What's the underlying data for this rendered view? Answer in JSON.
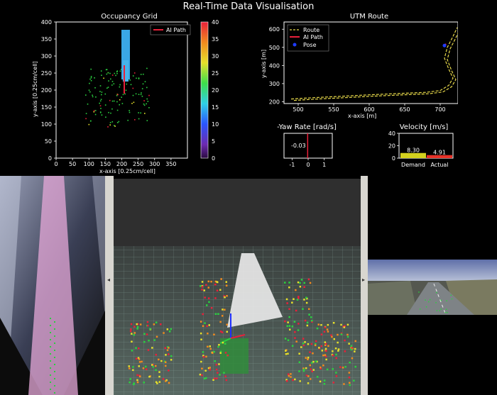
{
  "window_title": "Real-Time Data Visualisation",
  "occupancy": {
    "title": "Occupancy Grid",
    "xlabel": "x-axis [0.25cm/cell]",
    "ylabel": "y-axis [0.25cm/cell]",
    "xticks": [
      "0",
      "50",
      "100",
      "150",
      "200",
      "250",
      "300",
      "350"
    ],
    "yticks": [
      "0",
      "50",
      "100",
      "150",
      "200",
      "250",
      "300",
      "350",
      "400"
    ],
    "legend": "AI Path",
    "colorbar_ticks": [
      "0",
      "5",
      "10",
      "15",
      "20",
      "25",
      "30",
      "35",
      "40"
    ]
  },
  "utm": {
    "title": "UTM Route",
    "xlabel": "x-axis [m]",
    "ylabel": "y-axis [m]",
    "xticks": [
      "500",
      "550",
      "600",
      "650",
      "700"
    ],
    "yticks": [
      "200",
      "300",
      "400",
      "500",
      "600"
    ],
    "legend": [
      "Route",
      "AI Path",
      "Pose"
    ]
  },
  "yaw": {
    "title": "-Yaw Rate [rad/s]",
    "value": "-0.03",
    "xticks": [
      "-1",
      "0",
      "1"
    ]
  },
  "velocity": {
    "title": "Velocity [m/s]",
    "yticks": [
      "0",
      "20",
      "40"
    ],
    "categories": [
      "Demand",
      "Actual"
    ],
    "value_labels": [
      "8.30",
      "4.91"
    ]
  },
  "colors": {
    "route": "#e6d84a",
    "ai_path": "#e8203a",
    "pose": "#1f3cff",
    "occupancy_path": "#3aa7e6",
    "demand_bar": "#d4d21e",
    "actual_bar": "#e83228"
  },
  "chart_data": [
    {
      "type": "bar",
      "title": "Velocity [m/s]",
      "categories": [
        "Demand",
        "Actual"
      ],
      "values": [
        8.3,
        4.91
      ],
      "ylim": [
        0,
        40
      ]
    },
    {
      "type": "bar",
      "title": "-Yaw Rate [rad/s]",
      "categories": [
        ""
      ],
      "values": [
        -0.03
      ],
      "xlim": [
        -1.5,
        1.5
      ]
    },
    {
      "type": "line",
      "title": "UTM Route",
      "xlabel": "x-axis [m]",
      "ylabel": "y-axis [m]",
      "xlim": [
        480,
        725
      ],
      "ylim": [
        190,
        640
      ],
      "series": [
        {
          "name": "Route",
          "x": [
            490,
            520,
            560,
            600,
            640,
            680,
            700,
            712,
            718,
            712,
            706,
            710,
            718,
            724
          ],
          "y": [
            215,
            222,
            230,
            238,
            245,
            252,
            262,
            290,
            330,
            380,
            440,
            500,
            560,
            610
          ]
        },
        {
          "name": "AI Path",
          "x": [
            706,
            708
          ],
          "y": [
            505,
            520
          ]
        },
        {
          "name": "Pose",
          "x": [
            706
          ],
          "y": [
            510
          ]
        }
      ]
    }
  ]
}
